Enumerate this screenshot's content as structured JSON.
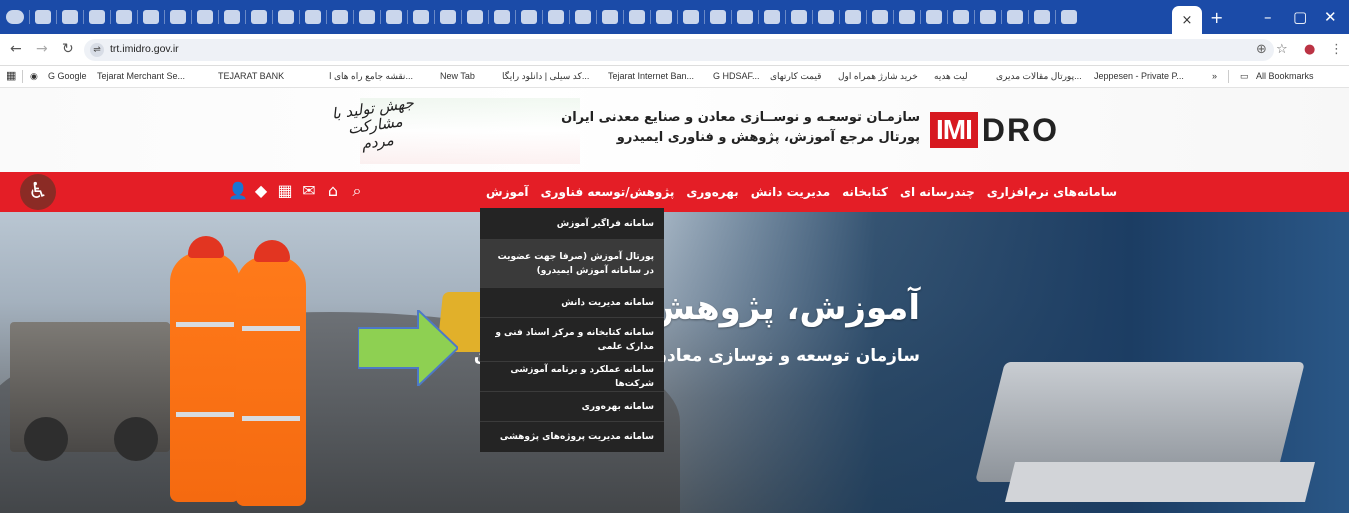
{
  "browser": {
    "active_tab_close": "×",
    "new_tab": "+",
    "window_controls": [
      "–",
      "▢",
      "✕"
    ],
    "url": "trt.imidro.gov.ir",
    "bookmarks": [
      "G Google",
      "Tejarat Merchant Se...",
      "TEJARAT BANK",
      "نقشه جامع راه های ا...",
      "New Tab",
      "کد سیلی | دانلود رایگا...",
      "Tejarat Internet Ban...",
      "G HDSAF...",
      "قیمت کارتهای",
      "خرید شارژ همراه اول",
      "لیت هدیه",
      "پورتال مقالات مدیری...",
      "Jeppesen - Private P..."
    ],
    "more_bookmarks": "»",
    "all_bookmarks": "All Bookmarks"
  },
  "site": {
    "org_title": "سازمـان توسعـه و نوســازی معادن و صنایع معدنی ایران",
    "portal_title": "پورتال مرجع آموزش، پژوهش و فناوری ایمیدرو",
    "logo_left": "IMI",
    "logo_right": "DRO",
    "slogan": "جهش تولید با مشارکت مردم",
    "menu": [
      "آموزش",
      "پژوهش/توسعه فناوری",
      "بهره‌وری",
      "مدیریت دانش",
      "کتابخانه",
      "چندرسانه ای",
      "سامانه‌های نرم‌افزاری"
    ],
    "hero_title": "آموزش، پژوهش و فناوری",
    "hero_subtitle": "سازمان توسعه و نوسازی معادن و صنایع معدنی ایران",
    "dropdown": [
      "سامانه فراگیر آموزش",
      "پورتال آموزش (صرفا جهت عضویت در سامانه آموزش ایمیدرو)",
      "سامانه مدیریت دانش",
      "سامانه کتابخانه و مرکز اسناد فنی و مدارک علمی",
      "سامانه عملکرد و برنامه آموزشی شرکت‌ها",
      "سامانه بهره‌وری",
      "سامانه مدیریت پروژه‌های پژوهشی"
    ],
    "colors": {
      "accent": "#e41e26",
      "dropdown_bg": "#242424",
      "browser": "#1b4ba8"
    }
  }
}
